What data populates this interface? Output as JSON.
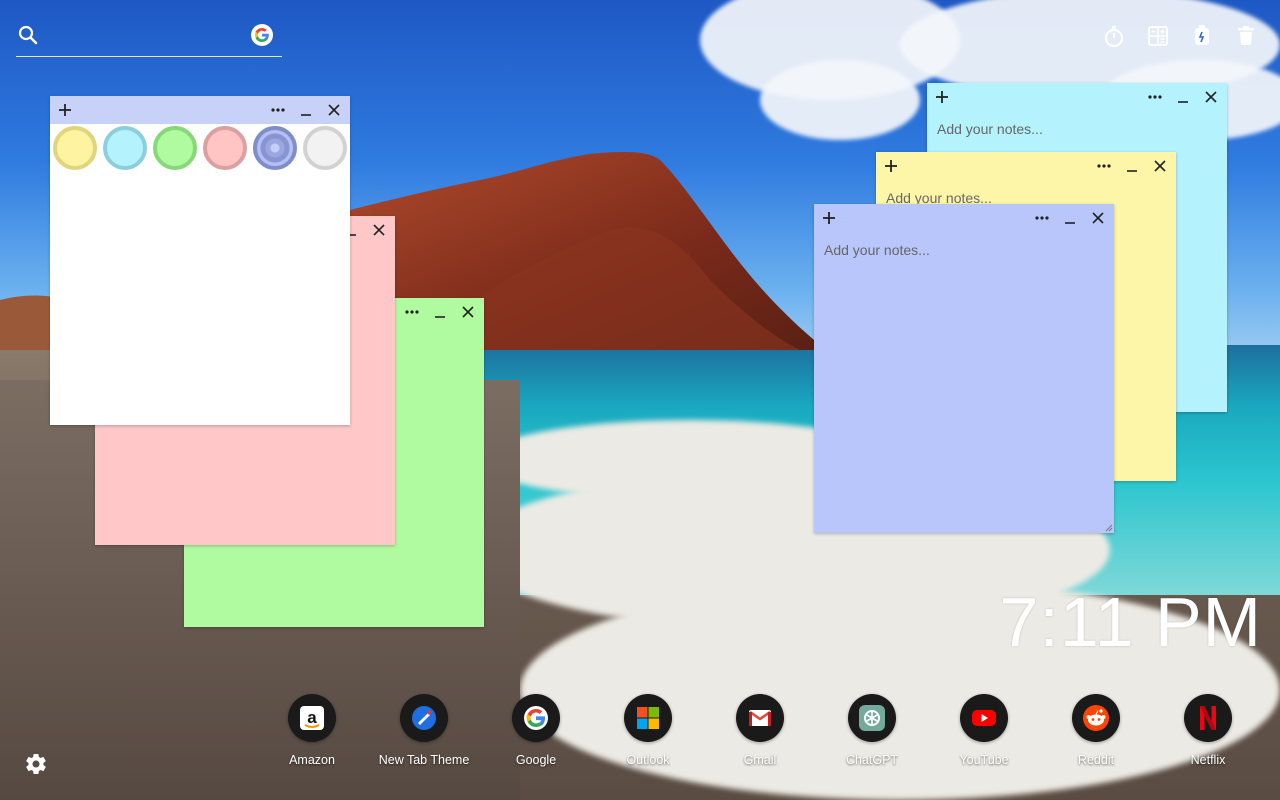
{
  "search": {
    "placeholder": ""
  },
  "top_tools": [
    {
      "icon": "timer-icon"
    },
    {
      "icon": "calculator-icon"
    },
    {
      "icon": "stopwatch-icon"
    },
    {
      "icon": "trash-icon"
    }
  ],
  "notes": {
    "white": {
      "color": "#ffffff",
      "bar_color": "#c8d2f8"
    },
    "pink": {
      "color": "#ffc7c7"
    },
    "green": {
      "color": "#b0fba0"
    },
    "cyan": {
      "color": "#b4f2fd",
      "placeholder": "Add your notes..."
    },
    "yellow": {
      "color": "#fdf6a8",
      "placeholder": "Add your notes..."
    },
    "blue": {
      "color": "#b9c6fb",
      "placeholder": "Add your notes..."
    }
  },
  "color_options": [
    {
      "name": "yellow",
      "fill": "#fdf3a0",
      "ring": "#e1d47a"
    },
    {
      "name": "cyan",
      "fill": "#b4f2fd",
      "ring": "#8ccfdc"
    },
    {
      "name": "green",
      "fill": "#b0fba0",
      "ring": "#86d878"
    },
    {
      "name": "pink",
      "fill": "#ffc4c4",
      "ring": "#dca0a0"
    },
    {
      "name": "blue",
      "fill": "#b4c0f4",
      "ring": "#7f8ec8",
      "selected": true
    },
    {
      "name": "white",
      "fill": "#f2f2f2",
      "ring": "#d2d2d2"
    }
  ],
  "clock": {
    "time": "7:11 PM"
  },
  "dock": [
    {
      "label": "Amazon",
      "icon": "amazon-icon"
    },
    {
      "label": "New Tab Theme",
      "icon": "new-tab-theme-icon"
    },
    {
      "label": "Google",
      "icon": "google-icon"
    },
    {
      "label": "Outlook",
      "icon": "outlook-icon"
    },
    {
      "label": "Gmail",
      "icon": "gmail-icon"
    },
    {
      "label": "ChatGPT",
      "icon": "chatgpt-icon"
    },
    {
      "label": "YouTube",
      "icon": "youtube-icon"
    },
    {
      "label": "Reddit",
      "icon": "reddit-icon"
    },
    {
      "label": "Netflix",
      "icon": "netflix-icon"
    }
  ]
}
